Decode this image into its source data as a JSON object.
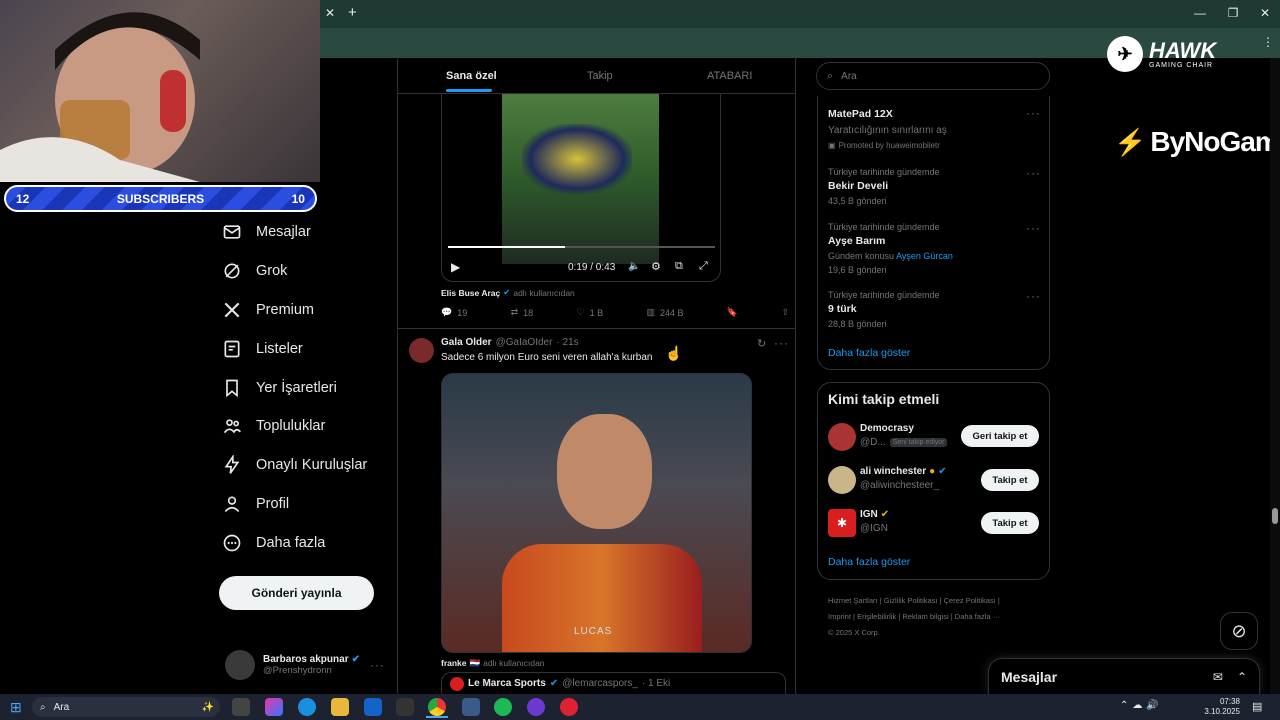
{
  "webcam": {
    "subscribers_left": "12",
    "subscribers_label": "SUBSCRIBERS",
    "subscribers_right": "10"
  },
  "branding": {
    "hawk": "HAWK",
    "hawk_sub": "GAMING CHAIR",
    "bynogame": "ByNoGame"
  },
  "nav": {
    "items": [
      "Mesajlar",
      "Grok",
      "Premium",
      "Listeler",
      "Yer İşaretleri",
      "Topluluklar",
      "Onaylı Kuruluşlar",
      "Profil",
      "Daha fazla"
    ],
    "post_button": "Gönderi yayınla"
  },
  "account": {
    "name": "Barbaros akpunar",
    "handle": "@Prenshydronn"
  },
  "feed": {
    "tabs": [
      "Sana özel",
      "Takip",
      "ATABARI"
    ],
    "video": {
      "time": "0:19 / 0:43"
    },
    "post1": {
      "reposted_by": "Elis Buse Araç",
      "reposted_suffix": "adlı kullanıcıdan",
      "replies": "19",
      "reposts": "18",
      "likes": "1 B",
      "views": "244 B"
    },
    "post2": {
      "name": "Gala Older",
      "handle": "@GaIaOIder",
      "time": "· 21s",
      "text": "Sadece 6 milyon Euro seni veren allah'a kurban",
      "image_caption": "LUCAS",
      "reposted_by": "franke",
      "reposted_suffix": "adlı kullanıcıdan"
    },
    "quote": {
      "name": "Le Marca Sports",
      "handle": "@lemarcaspors_",
      "time": "· 1 Eki"
    }
  },
  "sidebar": {
    "search_placeholder": "Ara",
    "ad": {
      "title": "MatePad 12X",
      "subtitle": "Yaratıcılığının sınırlarını aş",
      "promoted": "Promoted by huaweimobiletr"
    },
    "trends": [
      {
        "context": "Türkiye tarihinde gündemde",
        "name": "Bekir Develi",
        "extra": "",
        "count": "43,5 B gönderi"
      },
      {
        "context": "Türkiye tarihinde gündemde",
        "name": "Ayşe Barım",
        "extra": "Gündem konusu",
        "extra_link": "Ayşen Gürcan",
        "count": "19,6 B gönderi"
      },
      {
        "context": "Türkiye tarihinde gündemde",
        "name": "9 türk",
        "extra": "",
        "count": "28,8 B gönderi"
      }
    ],
    "show_more": "Daha fazla göster",
    "who_to_follow": {
      "title": "Kimi takip etmeli",
      "show_more": "Daha fazla göster",
      "users": [
        {
          "name": "Democrasy",
          "handle": "@D...",
          "badge": "Seni takip ediyor",
          "button": "Geri takip et"
        },
        {
          "name": "ali winchester",
          "handle": "@aliwinchesteer_",
          "badge": "",
          "button": "Takip et"
        },
        {
          "name": "IGN",
          "handle": "@IGN",
          "badge": "",
          "button": "Takip et"
        }
      ]
    },
    "footer": [
      "Hizmet Şartları",
      "|",
      "Gizlilik Politikası",
      "|",
      "Çerez Politikası",
      "|",
      "Imprint",
      "|",
      "Erişilebilirlik",
      "|",
      "Reklam bilgisi",
      "|",
      "Daha fazla ···",
      "© 2025 X Corp."
    ]
  },
  "messages_drawer": {
    "title": "Mesajlar"
  },
  "taskbar": {
    "search": "Ara",
    "time": "07:38",
    "date": "3.10.2025"
  },
  "colors": {
    "accent": "#1d9bf0",
    "bg": "#000000",
    "chrome": "#1f3a33"
  }
}
